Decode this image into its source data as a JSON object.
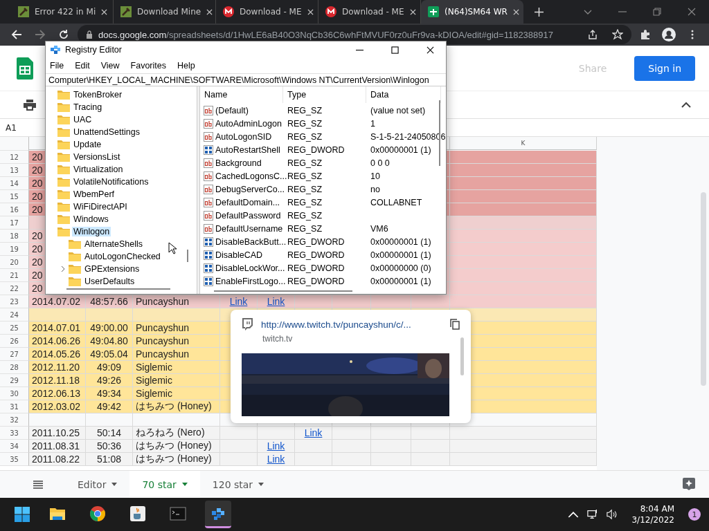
{
  "browser": {
    "tabs": [
      {
        "title": "Error 422 in Mi",
        "kind": "block",
        "selected": false
      },
      {
        "title": "Download Mine",
        "kind": "block",
        "selected": false
      },
      {
        "title": "Download - ME",
        "kind": "mega",
        "selected": false
      },
      {
        "title": "Download - ME",
        "kind": "mega",
        "selected": false
      },
      {
        "title": "(N64)SM64 WR",
        "kind": "sheets",
        "selected": true
      }
    ],
    "url_host": "docs.google.com",
    "url_path": "/spreadsheets/d/1HwLE6aB40O3NqCb36C6whFtMVUF0rz0uFr9va-kDIOA/edit#gid=1182388917"
  },
  "sheets": {
    "share": "Share",
    "sign_in": "Sign in",
    "name_box": "A1",
    "column_headers": {
      "K": "K"
    },
    "rows": [
      {
        "number": "12",
        "color": "#e6a3a0",
        "cells": {
          "A": "20"
        }
      },
      {
        "number": "13",
        "color": "#e6a3a0",
        "cells": {
          "A": "20"
        }
      },
      {
        "number": "14",
        "color": "#e6a3a0",
        "cells": {
          "A": "20"
        }
      },
      {
        "number": "15",
        "color": "#e6a3a0",
        "cells": {
          "A": "20"
        }
      },
      {
        "number": "16",
        "color": "#e6a3a0",
        "cells": {
          "A": "20"
        }
      },
      {
        "number": "17",
        "color": "#efcfcf",
        "cells": {}
      },
      {
        "number": "18",
        "color": "#f4cccc",
        "cells": {
          "A": "20"
        }
      },
      {
        "number": "19",
        "color": "#f4cccc",
        "cells": {
          "A": "20"
        }
      },
      {
        "number": "20",
        "color": "#f4cccc",
        "cells": {
          "A": "20"
        }
      },
      {
        "number": "21",
        "color": "#f4cccc",
        "cells": {
          "A": "20"
        }
      },
      {
        "number": "22",
        "color": "#f4cccc",
        "cells": {
          "A": "20"
        }
      },
      {
        "number": "23",
        "color": "#f4cccc",
        "cells": {
          "A": "2014.07.02",
          "B": "48:57.66",
          "C": "Puncayshun"
        },
        "links": {
          "D": "Link",
          "E": "Link"
        }
      },
      {
        "number": "24",
        "color": "#fbe8b4",
        "cells": {}
      },
      {
        "number": "25",
        "color": "#ffe599",
        "cells": {
          "A": "2014.07.01",
          "B": "49:00.00",
          "C": "Puncayshun"
        }
      },
      {
        "number": "26",
        "color": "#ffe599",
        "cells": {
          "A": "2014.06.26",
          "B": "49:04.80",
          "C": "Puncayshun"
        }
      },
      {
        "number": "27",
        "color": "#ffe599",
        "cells": {
          "A": "2014.05.26",
          "B": "49:05.04",
          "C": "Puncayshun"
        }
      },
      {
        "number": "28",
        "color": "#ffe599",
        "cells": {
          "A": "2012.11.20",
          "B": "49:09",
          "C": "Siglemic"
        }
      },
      {
        "number": "29",
        "color": "#ffe599",
        "cells": {
          "A": "2012.11.18",
          "B": "49:26",
          "C": "Siglemic"
        }
      },
      {
        "number": "30",
        "color": "#ffe599",
        "cells": {
          "A": "2012.06.13",
          "B": "49:34",
          "C": "Siglemic"
        }
      },
      {
        "number": "31",
        "color": "#ffe599",
        "cells": {
          "A": "2012.03.02",
          "B": "49:42",
          "C": "はちみつ (Honey)"
        }
      },
      {
        "number": "32",
        "color": "#f8f9fa",
        "cells": {}
      },
      {
        "number": "33",
        "color": "#f3f3f3",
        "cells": {
          "A": "2011.10.25",
          "B": "50:14",
          "C": "ねろねろ (Nero)"
        },
        "links": {
          "F": "Link"
        }
      },
      {
        "number": "34",
        "color": "#f3f3f3",
        "cells": {
          "A": "2011.08.31",
          "B": "50:36",
          "C": "はちみつ (Honey)"
        },
        "links": {
          "E": "Link"
        }
      },
      {
        "number": "35",
        "color": "#f3f3f3",
        "cells": {
          "A": "2011.08.22",
          "B": "51:08",
          "C": "はちみつ (Honey)"
        },
        "links": {
          "E": "Link"
        }
      }
    ],
    "sheet_tabs": [
      {
        "label": "Editor",
        "selected": false
      },
      {
        "label": "70 star",
        "selected": true
      },
      {
        "label": "120 star",
        "selected": false
      }
    ]
  },
  "registry_editor": {
    "title": "Registry Editor",
    "menu": [
      "File",
      "Edit",
      "View",
      "Favorites",
      "Help"
    ],
    "address": "Computer\\HKEY_LOCAL_MACHINE\\SOFTWARE\\Microsoft\\Windows NT\\CurrentVersion\\Winlogon",
    "tree": [
      {
        "label": "TokenBroker",
        "selected": false
      },
      {
        "label": "Tracing",
        "selected": false
      },
      {
        "label": "UAC",
        "selected": false
      },
      {
        "label": "UnattendSettings",
        "selected": false
      },
      {
        "label": "Update",
        "selected": false
      },
      {
        "label": "VersionsList",
        "selected": false
      },
      {
        "label": "Virtualization",
        "selected": false
      },
      {
        "label": "VolatileNotifications",
        "selected": false
      },
      {
        "label": "WbemPerf",
        "selected": false
      },
      {
        "label": "WiFiDirectAPI",
        "selected": false
      },
      {
        "label": "Windows",
        "selected": false
      },
      {
        "label": "Winlogon",
        "selected": true,
        "expanded": true,
        "children": [
          {
            "label": "AlternateShells",
            "selected": false
          },
          {
            "label": "AutoLogonChecked",
            "selected": false
          },
          {
            "label": "GPExtensions",
            "selected": false,
            "expanded": false
          },
          {
            "label": "UserDefaults",
            "selected": false
          }
        ]
      }
    ],
    "columns": [
      "Name",
      "Type",
      "Data"
    ],
    "values": [
      {
        "name": "(Default)",
        "type": "REG_SZ",
        "data": "(value not set)",
        "kind": "string"
      },
      {
        "name": "AutoAdminLogon",
        "type": "REG_SZ",
        "data": "1",
        "kind": "string"
      },
      {
        "name": "AutoLogonSID",
        "type": "REG_SZ",
        "data": "S-1-5-21-24050806",
        "kind": "string"
      },
      {
        "name": "AutoRestartShell",
        "type": "REG_DWORD",
        "data": "0x00000001 (1)",
        "kind": "binary"
      },
      {
        "name": "Background",
        "type": "REG_SZ",
        "data": "0 0 0",
        "kind": "string"
      },
      {
        "name": "CachedLogonsC...",
        "type": "REG_SZ",
        "data": "10",
        "kind": "string"
      },
      {
        "name": "DebugServerCo...",
        "type": "REG_SZ",
        "data": "no",
        "kind": "string"
      },
      {
        "name": "DefaultDomain...",
        "type": "REG_SZ",
        "data": "COLLABNET",
        "kind": "string"
      },
      {
        "name": "DefaultPassword",
        "type": "REG_SZ",
        "kind": "string"
      },
      {
        "name": "DefaultUsername",
        "type": "REG_SZ",
        "data": "VM6",
        "kind": "string"
      },
      {
        "name": "DisableBackButt...",
        "type": "REG_DWORD",
        "data": "0x00000001 (1)",
        "kind": "binary"
      },
      {
        "name": "DisableCAD",
        "type": "REG_DWORD",
        "data": "0x00000001 (1)",
        "kind": "binary"
      },
      {
        "name": "DisableLockWor...",
        "type": "REG_DWORD",
        "data": "0x00000000 (0)",
        "kind": "binary"
      },
      {
        "name": "EnableFirstLogo...",
        "type": "REG_DWORD",
        "data": "0x00000001 (1)",
        "kind": "binary"
      }
    ]
  },
  "link_preview": {
    "url": "http://www.twitch.tv/puncayshun/c/...",
    "domain": "twitch.tv",
    "kind": "picture"
  },
  "taskbar": {
    "apps": [
      {
        "kind": "folder",
        "selected": false
      },
      {
        "kind": "browser",
        "selected": false
      },
      {
        "kind": "cup",
        "selected": false
      },
      {
        "kind": "terminal",
        "selected": false
      },
      {
        "kind": "cubes",
        "selected": true
      }
    ],
    "time": "8:04 AM",
    "date": "3/12/2022",
    "notifications": "1"
  }
}
